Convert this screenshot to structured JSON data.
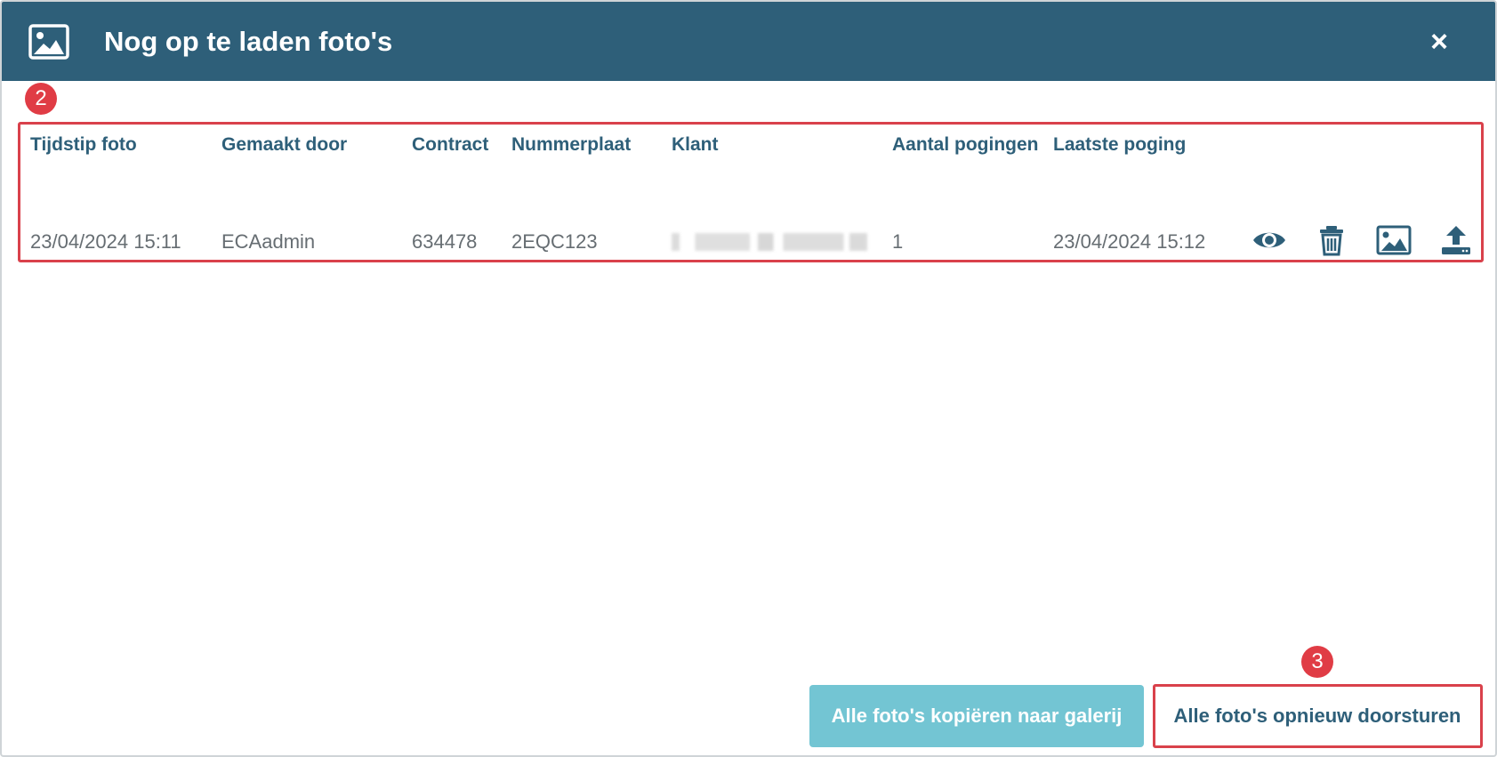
{
  "dialog": {
    "title": "Nog op te laden foto's",
    "close_label": "×"
  },
  "annotations": {
    "table_badge": "2",
    "footer_badge": "3"
  },
  "table": {
    "headers": [
      "Tijdstip foto",
      "Gemaakt door",
      "Contract",
      "Nummerplaat",
      "Klant",
      "Aantal pogingen",
      "Laatste poging"
    ],
    "rows": [
      {
        "tijdstip": "23/04/2024 15:11",
        "gemaakt_door": "ECAadmin",
        "contract": "634478",
        "nummerplaat": "2EQC123",
        "klant": "",
        "aantal_pogingen": "1",
        "laatste_poging": "23/04/2024 15:12",
        "actions": [
          "eye-icon",
          "trash-icon",
          "image-icon",
          "upload-icon"
        ]
      }
    ]
  },
  "footer": {
    "copy_label": "Alle foto's kopiëren naar galerij",
    "resend_label": "Alle foto's opnieuw doorsturen"
  },
  "colors": {
    "header": "#2e5f79",
    "copy_button": "#73c5d3",
    "highlight": "#d9414b"
  }
}
